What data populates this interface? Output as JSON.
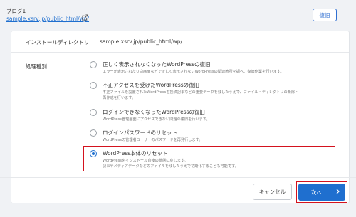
{
  "header": {
    "blog_name": "ブログ1",
    "blog_url": "sample.xsrv.jp/public_html/wp/",
    "restore_label": "復旧"
  },
  "install_dir": {
    "label": "インストールディレクトリ",
    "value": "sample.xsrv.jp/public_html/wp/"
  },
  "process": {
    "label": "処理種別",
    "options": [
      {
        "title": "正しく表示されなくなったWordPressの復旧",
        "desc": [
          "エラーが表示されたり白画面などで正しく表示されないWordPressの関連箇所を調べ、復旧作業を行います。"
        ],
        "selected": false
      },
      {
        "title": "不正アクセスを受けたWordPressの復旧",
        "desc": [
          "不正ファイルを設置されたWordPressを投稿記事などの重要データを残したうえで、ファイル・ディレクトリの新除・",
          "再作成を行います。"
        ],
        "selected": false
      },
      {
        "title": "ログインできなくなったWordPressの復旧",
        "desc": [
          "WordPress管理画面にアクセスできない問題の復旧を行います。"
        ],
        "selected": false
      },
      {
        "title": "ログインパスワードのリセット",
        "desc": [
          "WordPressの管理者ユーザーのパスワードを再発行します。"
        ],
        "selected": false
      },
      {
        "title": "WordPress本体のリセット",
        "desc": [
          "WordPressをインストール直後の状態に戻します。",
          "記事やメディアデータなどのファイルを残したうえで初期化することも可能です。"
        ],
        "selected": true
      }
    ]
  },
  "footer": {
    "cancel_label": "キャンセル",
    "next_label": "次へ"
  },
  "colors": {
    "accent": "#1f6fcf",
    "highlight": "#d4121e"
  }
}
